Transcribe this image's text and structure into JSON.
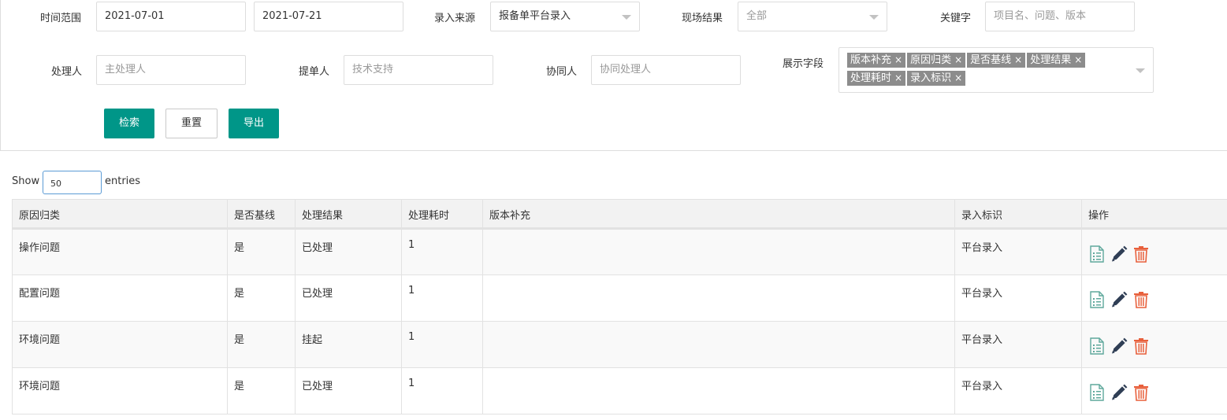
{
  "filters": {
    "time_range_label": "时间范围",
    "date_start": "2021-07-01",
    "date_end": "2021-07-21",
    "source_label": "录入来源",
    "source_value": "报备单平台录入",
    "result_label": "现场结果",
    "result_value": "全部",
    "keyword_label": "关键字",
    "keyword_placeholder": "项目名、问题、版本",
    "handler_label": "处理人",
    "handler_placeholder": "主处理人",
    "submitter_label": "提单人",
    "submitter_placeholder": "技术支持",
    "assist_label": "协同人",
    "assist_placeholder": "协同处理人",
    "fields_label": "展示字段",
    "field_tags": [
      "版本补充",
      "原因归类",
      "是否基线",
      "处理结果",
      "处理耗时",
      "录入标识"
    ],
    "tag_remove_glyph": "×"
  },
  "buttons": {
    "search": "检索",
    "reset": "重置",
    "export": "导出"
  },
  "entries": {
    "show": "Show",
    "value": "50",
    "suffix": "entries"
  },
  "table": {
    "headers": [
      "原因归类",
      "是否基线",
      "处理结果",
      "处理耗时",
      "版本补充",
      "录入标识",
      "操作"
    ],
    "rows": [
      [
        "操作问题",
        "是",
        "已处理",
        "1",
        "",
        "平台录入"
      ],
      [
        "配置问题",
        "是",
        "已处理",
        "1",
        "",
        "平台录入"
      ],
      [
        "环境问题",
        "是",
        "挂起",
        "1",
        "",
        "平台录入"
      ],
      [
        "环境问题",
        "是",
        "已处理",
        "1",
        "",
        "平台录入"
      ]
    ]
  },
  "colors": {
    "primary": "#009688",
    "view_icon": "#5fa89c",
    "edit_icon": "#2f3e55",
    "delete_icon": "#e8603c",
    "tag_bg": "#8c8c8c"
  },
  "row_icons": [
    "view-detail-icon",
    "edit-pencil-icon",
    "delete-trash-icon"
  ]
}
